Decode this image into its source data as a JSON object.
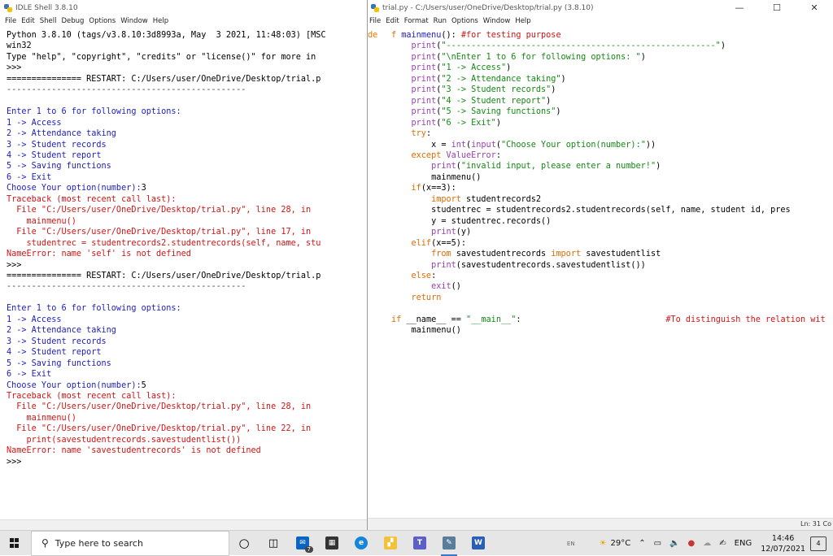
{
  "shell": {
    "title": "IDLE Shell 3.8.10",
    "menu": [
      "File",
      "Edit",
      "Shell",
      "Debug",
      "Options",
      "Window",
      "Help"
    ],
    "lines": [
      [
        {
          "t": "Python 3.8.10 (tags/v3.8.10:3d8993a, May  3 2021, 11:48:03) [MSC",
          "c": "blk"
        }
      ],
      [
        {
          "t": "win32",
          "c": "blk"
        }
      ],
      [
        {
          "t": "Type \"help\", \"copyright\", \"credits\" or \"license()\" for more in",
          "c": "blk"
        }
      ],
      [
        {
          "t": ">>> ",
          "c": "blk"
        }
      ],
      [
        {
          "t": "=============== RESTART: C:/Users/user/OneDrive/Desktop/trial.p",
          "c": "blk"
        }
      ],
      [
        {
          "t": "------------------------------------------------",
          "c": "dim"
        }
      ],
      [
        {
          "t": " ",
          "c": "blk"
        }
      ],
      [
        {
          "t": "Enter 1 to 6 for following options:",
          "c": "blu"
        }
      ],
      [
        {
          "t": "1 -> Access",
          "c": "blu"
        }
      ],
      [
        {
          "t": "2 -> Attendance taking",
          "c": "blu"
        }
      ],
      [
        {
          "t": "3 -> Student records",
          "c": "blu"
        }
      ],
      [
        {
          "t": "4 -> Student report",
          "c": "blu"
        }
      ],
      [
        {
          "t": "5 -> Saving functions",
          "c": "blu"
        }
      ],
      [
        {
          "t": "6 -> Exit",
          "c": "blu"
        }
      ],
      [
        {
          "t": "Choose Your option(number):",
          "c": "blu"
        },
        {
          "t": "3",
          "c": "blk"
        }
      ],
      [
        {
          "t": "Traceback (most recent call last):",
          "c": "red"
        }
      ],
      [
        {
          "t": "  File \"C:/Users/user/OneDrive/Desktop/trial.py\", line 28, in",
          "c": "red"
        }
      ],
      [
        {
          "t": "    mainmenu()",
          "c": "red"
        }
      ],
      [
        {
          "t": "  File \"C:/Users/user/OneDrive/Desktop/trial.py\", line 17, in",
          "c": "red"
        }
      ],
      [
        {
          "t": "    studentrec = studentrecords2.studentrecords(self, name, stu",
          "c": "red"
        }
      ],
      [
        {
          "t": "NameError: name 'self' is not defined",
          "c": "red"
        }
      ],
      [
        {
          "t": ">>> ",
          "c": "blk"
        }
      ],
      [
        {
          "t": "=============== RESTART: C:/Users/user/OneDrive/Desktop/trial.p",
          "c": "blk"
        }
      ],
      [
        {
          "t": "------------------------------------------------",
          "c": "dim"
        }
      ],
      [
        {
          "t": " ",
          "c": "blk"
        }
      ],
      [
        {
          "t": "Enter 1 to 6 for following options:",
          "c": "blu"
        }
      ],
      [
        {
          "t": "1 -> Access",
          "c": "blu"
        }
      ],
      [
        {
          "t": "2 -> Attendance taking",
          "c": "blu"
        }
      ],
      [
        {
          "t": "3 -> Student records",
          "c": "blu"
        }
      ],
      [
        {
          "t": "4 -> Student report",
          "c": "blu"
        }
      ],
      [
        {
          "t": "5 -> Saving functions",
          "c": "blu"
        }
      ],
      [
        {
          "t": "6 -> Exit",
          "c": "blu"
        }
      ],
      [
        {
          "t": "Choose Your option(number):",
          "c": "blu"
        },
        {
          "t": "5",
          "c": "blk"
        }
      ],
      [
        {
          "t": "Traceback (most recent call last):",
          "c": "red"
        }
      ],
      [
        {
          "t": "  File \"C:/Users/user/OneDrive/Desktop/trial.py\", line 28, in",
          "c": "red"
        }
      ],
      [
        {
          "t": "    mainmenu()",
          "c": "red"
        }
      ],
      [
        {
          "t": "  File \"C:/Users/user/OneDrive/Desktop/trial.py\", line 22, in",
          "c": "red"
        }
      ],
      [
        {
          "t": "    print(savestudentrecords.savestudentlist())",
          "c": "red"
        }
      ],
      [
        {
          "t": "NameError: name 'savestudentrecords' is not defined",
          "c": "red"
        }
      ],
      [
        {
          "t": ">>> ",
          "c": "blk"
        }
      ]
    ]
  },
  "editor": {
    "title": "trial.py - C:/Users/user/OneDrive/Desktop/trial.py (3.8.10)",
    "menu": [
      "File",
      "Edit",
      "Format",
      "Run",
      "Options",
      "Window",
      "Help"
    ],
    "gutter": "de",
    "lines": [
      [
        {
          "t": "f ",
          "c": "org"
        },
        {
          "t": "mainmenu",
          "c": "blu"
        },
        {
          "t": "(): ",
          "c": "blk"
        },
        {
          "t": "#for testing purpose",
          "c": "red"
        }
      ],
      [
        {
          "t": "    print",
          "c": "pur"
        },
        {
          "t": "(",
          "c": "blk"
        },
        {
          "t": "\"------------------------------------------------------\"",
          "c": "grn"
        },
        {
          "t": ")",
          "c": "blk"
        }
      ],
      [
        {
          "t": "    print",
          "c": "pur"
        },
        {
          "t": "(",
          "c": "blk"
        },
        {
          "t": "\"\\nEnter 1 to 6 for following options: \"",
          "c": "grn"
        },
        {
          "t": ")",
          "c": "blk"
        }
      ],
      [
        {
          "t": "    print",
          "c": "pur"
        },
        {
          "t": "(",
          "c": "blk"
        },
        {
          "t": "\"1 -> Access\"",
          "c": "grn"
        },
        {
          "t": ")",
          "c": "blk"
        }
      ],
      [
        {
          "t": "    print",
          "c": "pur"
        },
        {
          "t": "(",
          "c": "blk"
        },
        {
          "t": "\"2 -> Attendance taking\"",
          "c": "grn"
        },
        {
          "t": ")",
          "c": "blk"
        }
      ],
      [
        {
          "t": "    print",
          "c": "pur"
        },
        {
          "t": "(",
          "c": "blk"
        },
        {
          "t": "\"3 -> Student records\"",
          "c": "grn"
        },
        {
          "t": ")",
          "c": "blk"
        }
      ],
      [
        {
          "t": "    print",
          "c": "pur"
        },
        {
          "t": "(",
          "c": "blk"
        },
        {
          "t": "\"4 -> Student report\"",
          "c": "grn"
        },
        {
          "t": ")",
          "c": "blk"
        }
      ],
      [
        {
          "t": "    print",
          "c": "pur"
        },
        {
          "t": "(",
          "c": "blk"
        },
        {
          "t": "\"5 -> Saving functions\"",
          "c": "grn"
        },
        {
          "t": ")",
          "c": "blk"
        }
      ],
      [
        {
          "t": "    print",
          "c": "pur"
        },
        {
          "t": "(",
          "c": "blk"
        },
        {
          "t": "\"6 -> Exit\"",
          "c": "grn"
        },
        {
          "t": ")",
          "c": "blk"
        }
      ],
      [
        {
          "t": "    try",
          "c": "org"
        },
        {
          "t": ":",
          "c": "blk"
        }
      ],
      [
        {
          "t": "        x = ",
          "c": "blk"
        },
        {
          "t": "int",
          "c": "pur"
        },
        {
          "t": "(",
          "c": "blk"
        },
        {
          "t": "input",
          "c": "pur"
        },
        {
          "t": "(",
          "c": "blk"
        },
        {
          "t": "\"Choose Your option(number):\"",
          "c": "grn"
        },
        {
          "t": "))",
          "c": "blk"
        }
      ],
      [
        {
          "t": "    except ",
          "c": "org"
        },
        {
          "t": "ValueError",
          "c": "pur"
        },
        {
          "t": ":",
          "c": "blk"
        }
      ],
      [
        {
          "t": "        print",
          "c": "pur"
        },
        {
          "t": "(",
          "c": "blk"
        },
        {
          "t": "\"invalid input, please enter a number!\"",
          "c": "grn"
        },
        {
          "t": ")",
          "c": "blk"
        }
      ],
      [
        {
          "t": "        mainmenu()",
          "c": "blk"
        }
      ],
      [
        {
          "t": "    if",
          "c": "org"
        },
        {
          "t": "(x==3):",
          "c": "blk"
        }
      ],
      [
        {
          "t": "        import ",
          "c": "org"
        },
        {
          "t": "studentrecords2",
          "c": "blk"
        }
      ],
      [
        {
          "t": "        studentrec = studentrecords2.studentrecords(self, name, student id, pres",
          "c": "blk"
        }
      ],
      [
        {
          "t": "        y = studentrec.records()",
          "c": "blk"
        }
      ],
      [
        {
          "t": "        print",
          "c": "pur"
        },
        {
          "t": "(y)",
          "c": "blk"
        }
      ],
      [
        {
          "t": "    elif",
          "c": "org"
        },
        {
          "t": "(x==5):",
          "c": "blk"
        }
      ],
      [
        {
          "t": "        from ",
          "c": "org"
        },
        {
          "t": "savestudentrecords ",
          "c": "blk"
        },
        {
          "t": "import ",
          "c": "org"
        },
        {
          "t": "savestudentlist",
          "c": "blk"
        }
      ],
      [
        {
          "t": "        print",
          "c": "pur"
        },
        {
          "t": "(savestudentrecords.savestudentlist())",
          "c": "blk"
        }
      ],
      [
        {
          "t": "    else",
          "c": "org"
        },
        {
          "t": ":",
          "c": "blk"
        }
      ],
      [
        {
          "t": "        exit",
          "c": "pur"
        },
        {
          "t": "()",
          "c": "blk"
        }
      ],
      [
        {
          "t": "    return",
          "c": "org"
        }
      ],
      [
        {
          "t": " ",
          "c": "blk"
        }
      ],
      [
        {
          "t": "if ",
          "c": "org"
        },
        {
          "t": "__name__ == ",
          "c": "blk"
        },
        {
          "t": "\"__main__\"",
          "c": "grn"
        },
        {
          "t": ":                             ",
          "c": "blk"
        },
        {
          "t": "#To distinguish the relation wit",
          "c": "red"
        }
      ],
      [
        {
          "t": "    mainmenu()",
          "c": "blk"
        }
      ]
    ],
    "status": "Ln: 31  Co"
  },
  "taskbar": {
    "search_placeholder": "Type here to search",
    "mail_badge": "7",
    "language_hint": "EN",
    "weather": "29°C",
    "lang": "ENG",
    "time": "14:46",
    "date": "12/07/2021",
    "notifications": "4"
  }
}
